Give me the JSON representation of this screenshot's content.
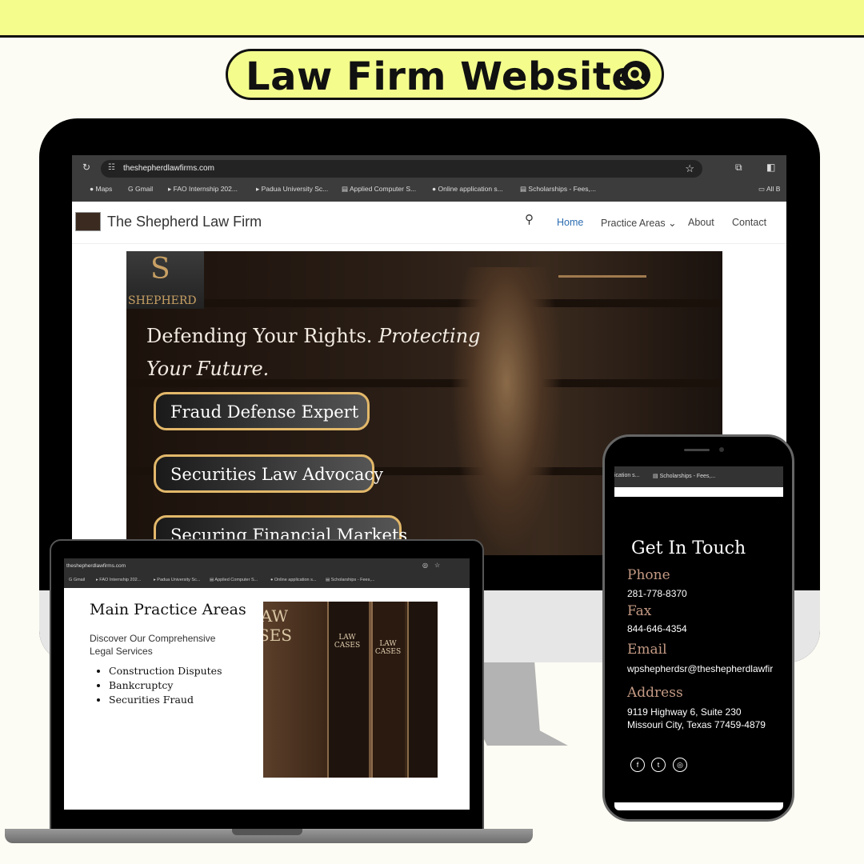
{
  "banner": {
    "title": "Law Firm Website",
    "icon": "search-icon"
  },
  "desktop": {
    "url": "theshepherdlawfirms.com",
    "bookmarks": [
      "Maps",
      "Gmail",
      "FAO Internship 202...",
      "Padua University Sc...",
      "Applied Computer S...",
      "Online application s...",
      "Scholarships - Fees,...",
      "All B"
    ],
    "site_title": "The Shepherd Law Firm",
    "nav": {
      "home": "Home",
      "practice": "Practice Areas",
      "about": "About",
      "contact": "Contact"
    },
    "hero": {
      "logo_text": "SHEPHERD",
      "headline_1": "Defending Your Rights.",
      "headline_2": "Protecting",
      "headline_3": "Your Future.",
      "buttons": [
        "Fraud Defense Expert",
        "Securities Law Advocacy",
        "Securing Financial Markets"
      ]
    },
    "colors": {
      "link": "#2b6cb0",
      "gold": "#e2b86a",
      "banner": "#f4fd8c"
    }
  },
  "laptop": {
    "url": "theshepherdlawfirms.com",
    "bookmarks": [
      "Gmail",
      "FAO Internship 202...",
      "Padua University Sc...",
      "Applied Computer S...",
      "Online application s...",
      "Scholarships - Fees,..."
    ],
    "heading": "Main Practice Areas",
    "subheading": "Discover Our Comprehensive Legal Services",
    "items": [
      "Construction Disputes",
      "Bankcruptcy",
      "Securities Fraud"
    ],
    "book_labels": [
      "LAW\nCASES",
      "LAW\nCASES",
      "AW\nSES"
    ]
  },
  "phone": {
    "bookmarks": [
      "ication s...",
      "Scholarships - Fees,..."
    ],
    "heading": "Get In Touch",
    "phone_label": "Phone",
    "phone": "281-778-8370",
    "fax_label": "Fax",
    "fax": "844-646-4354",
    "email_label": "Email",
    "email": "wpshepherdsr@theshepherdlawfir",
    "address_label": "Address",
    "address_1": "9119 Highway 6, Suite 230",
    "address_2": "Missouri City, Texas 77459-4879",
    "social": [
      "facebook-icon",
      "twitter-icon",
      "instagram-icon"
    ]
  }
}
